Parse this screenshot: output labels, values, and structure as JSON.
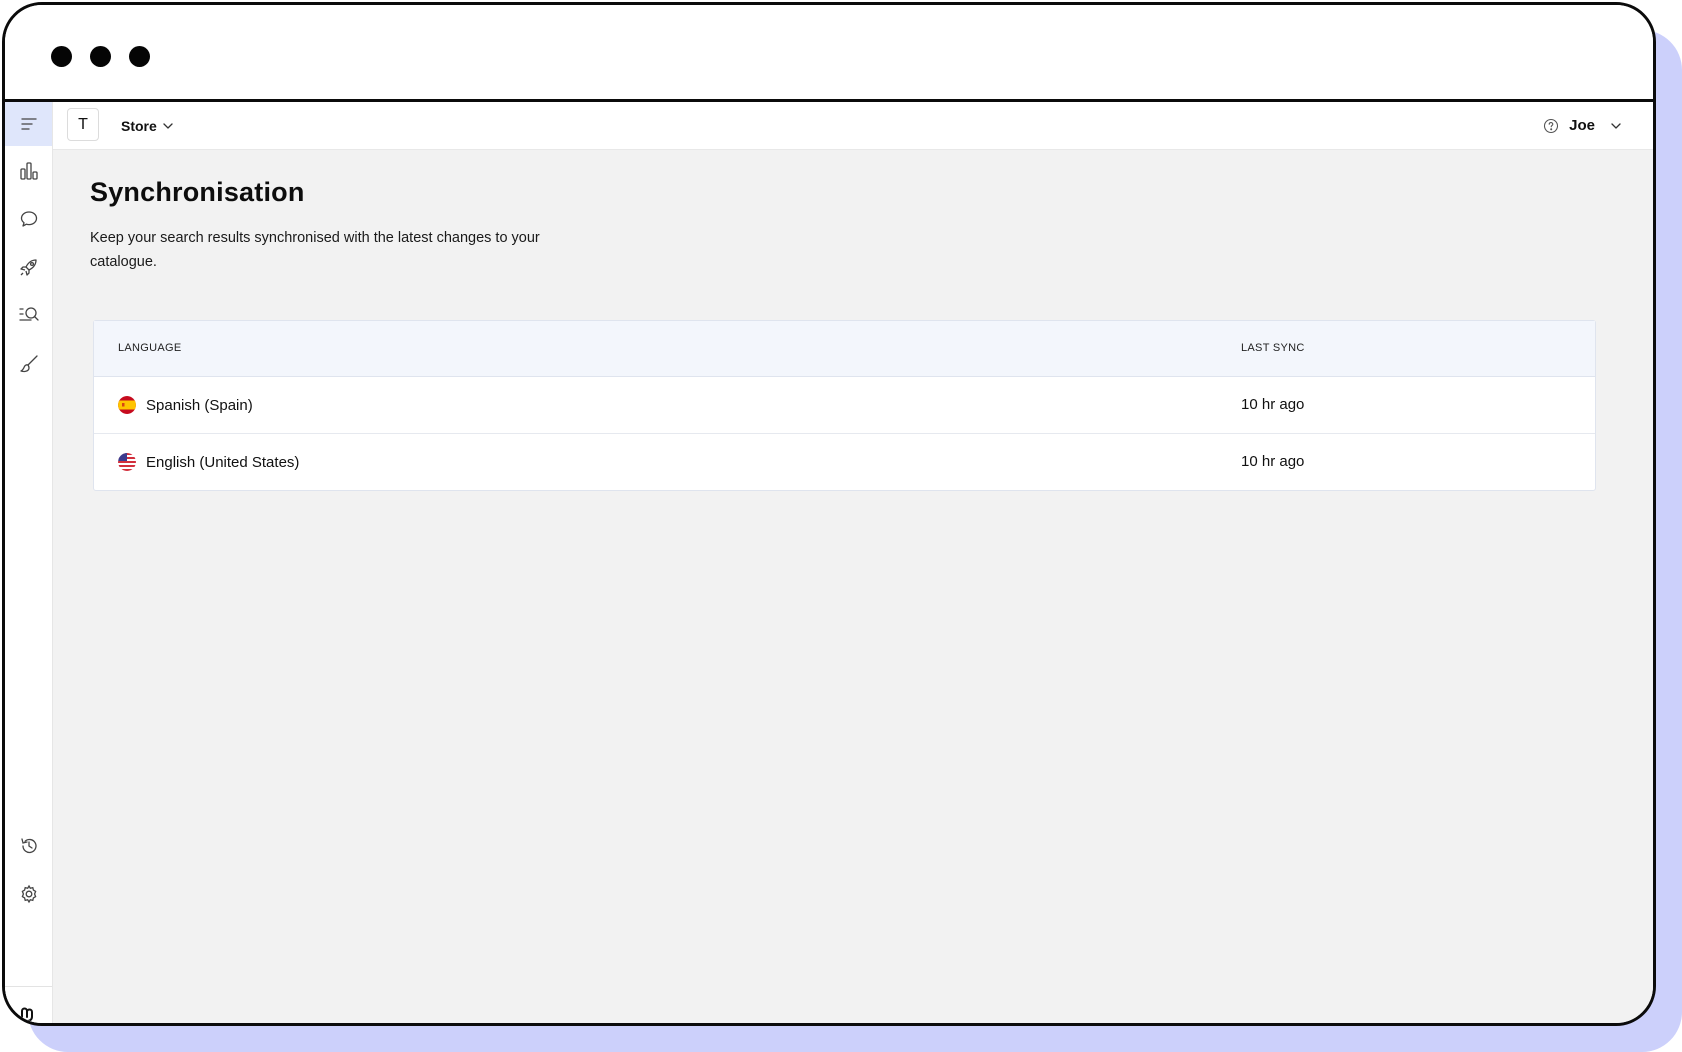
{
  "topbar": {
    "store_initial": "T",
    "store_name": "Store",
    "user_name": "Joe"
  },
  "sidebar": {
    "items": [
      {
        "name": "menu-icon",
        "active": true
      },
      {
        "name": "analytics-icon"
      },
      {
        "name": "chat-icon"
      },
      {
        "name": "rocket-icon"
      },
      {
        "name": "search-list-icon"
      },
      {
        "name": "brush-icon"
      }
    ],
    "bottom_items": [
      {
        "name": "history-icon"
      },
      {
        "name": "gear-icon"
      },
      {
        "name": "logo-icon"
      }
    ]
  },
  "page": {
    "title": "Synchronisation",
    "description": "Keep your search results synchronised with the latest changes to your catalogue."
  },
  "table": {
    "columns": [
      "LANGUAGE",
      "LAST SYNC"
    ],
    "rows": [
      {
        "flag": "spain-flag-icon",
        "language": "Spanish (Spain)",
        "last_sync": "10 hr ago"
      },
      {
        "flag": "us-flag-icon",
        "language": "English (United States)",
        "last_sync": "10 hr ago"
      }
    ]
  },
  "colors": {
    "frame_shadow": "#ccd0fb",
    "active_nav": "#dfe6fb",
    "table_header": "#f3f6fc",
    "content_bg": "#f2f2f2"
  }
}
